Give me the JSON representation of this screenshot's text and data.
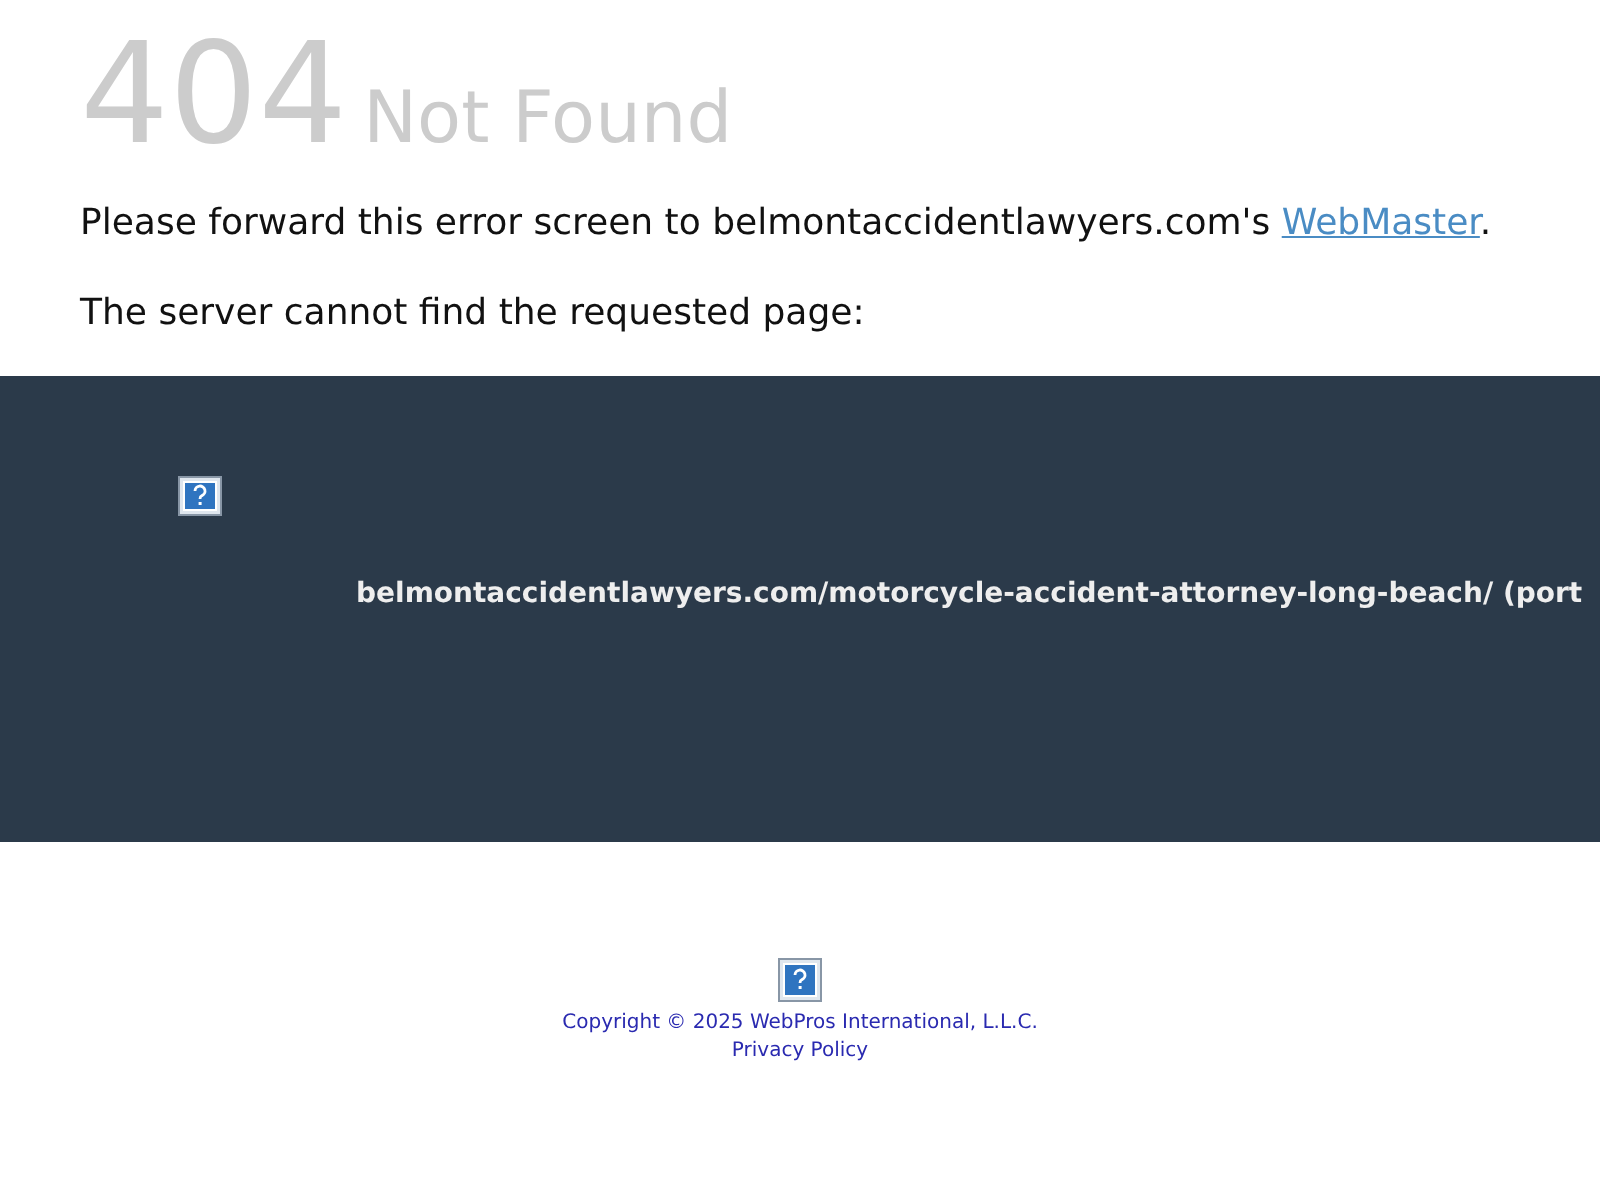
{
  "heading": {
    "code": "404",
    "title": "Not Found"
  },
  "message": {
    "text_before": "Please forward this error screen to belmontaccidentlawyers.com's ",
    "link": "WebMaster",
    "text_after": "."
  },
  "subtext": "The server cannot find the requested page:",
  "error_panel": {
    "url": "belmontaccidentlawyers.com/motorcycle-accident-attorney-long-beach/ (port"
  },
  "footer": {
    "copyright": "Copyright © 2025 WebPros International, L.L.C.",
    "privacy_link": "Privacy Policy"
  }
}
